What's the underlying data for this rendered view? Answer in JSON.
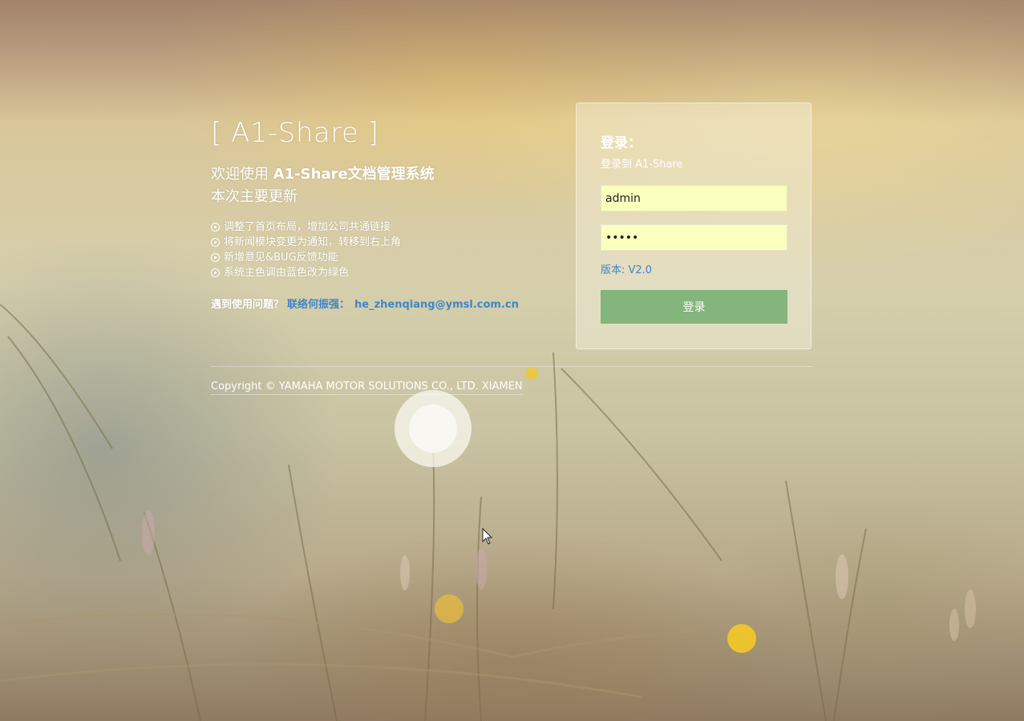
{
  "brand": "[ A1-Share ]",
  "welcome": {
    "prefix": "欢迎使用 ",
    "system_name": "A1-Share文档管理系统",
    "update_title": "本次主要更新"
  },
  "updates": [
    "调整了首页布局，增加公司共通链接",
    "将新闻模块变更为通知，转移到右上角",
    "新增意见&BUG反馈功能",
    "系统主色调由蓝色改为绿色"
  ],
  "help": {
    "label": "遇到使用问题？",
    "contact": "联络何振强：",
    "email": "he_zhenqiang@ymsl.com.cn"
  },
  "copyright": "Copyright © YAMAHA MOTOR SOLUTIONS CO., LTD. XIAMEN",
  "login": {
    "title": "登录：",
    "subtitle": "登录到 A1-Share",
    "username_value": "admin",
    "password_value": "•••••",
    "version": "版本: V2.0",
    "button_label": "登录"
  },
  "colors": {
    "accent_green": "#83b57d",
    "link_blue": "#3f86c9",
    "input_bg": "#fbffbe"
  }
}
